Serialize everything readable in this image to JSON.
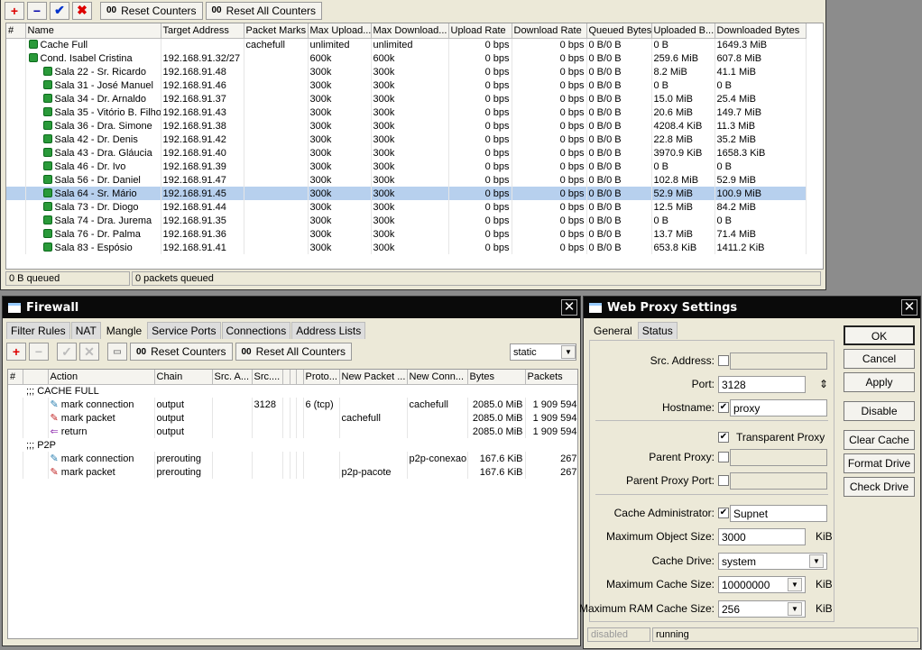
{
  "queues": {
    "toolbar": {
      "add": "+",
      "remove": "−",
      "enable": "✔",
      "disable": "✖",
      "reset_counters": "Reset Counters",
      "reset_all_counters": "Reset All Counters",
      "counter_glyph": "00"
    },
    "columns": [
      "#",
      "Name",
      "Target Address",
      "Packet Marks",
      "Max Upload...",
      "Max Download...",
      "Upload Rate",
      "Download Rate",
      "Queued Bytes",
      "Uploaded B...",
      "Downloaded Bytes"
    ],
    "rows": [
      {
        "level": 0,
        "name": "Cache Full",
        "target": "",
        "marks": "cachefull",
        "max_up": "unlimited",
        "max_down": "unlimited",
        "up_rate": "0 bps",
        "down_rate": "0 bps",
        "queued": "0 B/0 B",
        "uploaded": "0 B",
        "downloaded": "1649.3 MiB"
      },
      {
        "level": 0,
        "name": "Cond. Isabel Cristina",
        "target": "192.168.91.32/27",
        "marks": "",
        "max_up": "600k",
        "max_down": "600k",
        "up_rate": "0 bps",
        "down_rate": "0 bps",
        "queued": "0 B/0 B",
        "uploaded": "259.6 MiB",
        "downloaded": "607.8 MiB"
      },
      {
        "level": 1,
        "name": "Sala 22 - Sr. Ricardo",
        "target": "192.168.91.48",
        "marks": "",
        "max_up": "300k",
        "max_down": "300k",
        "up_rate": "0 bps",
        "down_rate": "0 bps",
        "queued": "0 B/0 B",
        "uploaded": "8.2 MiB",
        "downloaded": "41.1 MiB"
      },
      {
        "level": 1,
        "name": "Sala 31 - José Manuel",
        "target": "192.168.91.46",
        "marks": "",
        "max_up": "300k",
        "max_down": "300k",
        "up_rate": "0 bps",
        "down_rate": "0 bps",
        "queued": "0 B/0 B",
        "uploaded": "0 B",
        "downloaded": "0 B"
      },
      {
        "level": 1,
        "name": "Sala 34 - Dr. Arnaldo",
        "target": "192.168.91.37",
        "marks": "",
        "max_up": "300k",
        "max_down": "300k",
        "up_rate": "0 bps",
        "down_rate": "0 bps",
        "queued": "0 B/0 B",
        "uploaded": "15.0 MiB",
        "downloaded": "25.4 MiB"
      },
      {
        "level": 1,
        "name": "Sala 35 - Vitório B. Filho",
        "target": "192.168.91.43",
        "marks": "",
        "max_up": "300k",
        "max_down": "300k",
        "up_rate": "0 bps",
        "down_rate": "0 bps",
        "queued": "0 B/0 B",
        "uploaded": "20.6 MiB",
        "downloaded": "149.7 MiB"
      },
      {
        "level": 1,
        "name": "Sala 36 - Dra. Simone",
        "target": "192.168.91.38",
        "marks": "",
        "max_up": "300k",
        "max_down": "300k",
        "up_rate": "0 bps",
        "down_rate": "0 bps",
        "queued": "0 B/0 B",
        "uploaded": "4208.4 KiB",
        "downloaded": "11.3 MiB"
      },
      {
        "level": 1,
        "name": "Sala 42 - Dr. Denis",
        "target": "192.168.91.42",
        "marks": "",
        "max_up": "300k",
        "max_down": "300k",
        "up_rate": "0 bps",
        "down_rate": "0 bps",
        "queued": "0 B/0 B",
        "uploaded": "22.8 MiB",
        "downloaded": "35.2 MiB"
      },
      {
        "level": 1,
        "name": "Sala 43 - Dra. Gláucia",
        "target": "192.168.91.40",
        "marks": "",
        "max_up": "300k",
        "max_down": "300k",
        "up_rate": "0 bps",
        "down_rate": "0 bps",
        "queued": "0 B/0 B",
        "uploaded": "3970.9 KiB",
        "downloaded": "1658.3 KiB"
      },
      {
        "level": 1,
        "name": "Sala 46 - Dr. Ivo",
        "target": "192.168.91.39",
        "marks": "",
        "max_up": "300k",
        "max_down": "300k",
        "up_rate": "0 bps",
        "down_rate": "0 bps",
        "queued": "0 B/0 B",
        "uploaded": "0 B",
        "downloaded": "0 B"
      },
      {
        "level": 1,
        "name": "Sala 56 - Dr. Daniel",
        "target": "192.168.91.47",
        "marks": "",
        "max_up": "300k",
        "max_down": "300k",
        "up_rate": "0 bps",
        "down_rate": "0 bps",
        "queued": "0 B/0 B",
        "uploaded": "102.8 MiB",
        "downloaded": "52.9 MiB"
      },
      {
        "level": 1,
        "name": "Sala 64 - Sr. Mário",
        "target": "192.168.91.45",
        "marks": "",
        "max_up": "300k",
        "max_down": "300k",
        "up_rate": "0 bps",
        "down_rate": "0 bps",
        "queued": "0 B/0 B",
        "uploaded": "52.9 MiB",
        "downloaded": "100.9 MiB",
        "selected": true
      },
      {
        "level": 1,
        "name": "Sala 73 - Dr. Diogo",
        "target": "192.168.91.44",
        "marks": "",
        "max_up": "300k",
        "max_down": "300k",
        "up_rate": "0 bps",
        "down_rate": "0 bps",
        "queued": "0 B/0 B",
        "uploaded": "12.5 MiB",
        "downloaded": "84.2 MiB"
      },
      {
        "level": 1,
        "name": "Sala 74 - Dra. Jurema",
        "target": "192.168.91.35",
        "marks": "",
        "max_up": "300k",
        "max_down": "300k",
        "up_rate": "0 bps",
        "down_rate": "0 bps",
        "queued": "0 B/0 B",
        "uploaded": "0 B",
        "downloaded": "0 B"
      },
      {
        "level": 1,
        "name": "Sala 76 - Dr. Palma",
        "target": "192.168.91.36",
        "marks": "",
        "max_up": "300k",
        "max_down": "300k",
        "up_rate": "0 bps",
        "down_rate": "0 bps",
        "queued": "0 B/0 B",
        "uploaded": "13.7 MiB",
        "downloaded": "71.4 MiB"
      },
      {
        "level": 1,
        "name": "Sala 83 - Espósio",
        "target": "192.168.91.41",
        "marks": "",
        "max_up": "300k",
        "max_down": "300k",
        "up_rate": "0 bps",
        "down_rate": "0 bps",
        "queued": "0 B/0 B",
        "uploaded": "653.8 KiB",
        "downloaded": "1411.2 KiB"
      }
    ],
    "status": {
      "queued": "0 B queued",
      "packets": "0 packets queued"
    }
  },
  "firewall": {
    "title": "Firewall",
    "tabs": [
      "Filter Rules",
      "NAT",
      "Mangle",
      "Service Ports",
      "Connections",
      "Address Lists"
    ],
    "active_tab": "Mangle",
    "toolbar": {
      "reset_counters": "Reset Counters",
      "reset_all_counters": "Reset All Counters",
      "counter_glyph": "00",
      "filter": "static"
    },
    "columns": [
      "#",
      "",
      "Action",
      "Chain",
      "Src. A...",
      "Src....",
      "",
      "",
      "",
      "Proto...",
      "New Packet ...",
      "New Conn...",
      "Bytes",
      "Packets"
    ],
    "rows": [
      {
        "comment": ";;; CACHE FULL"
      },
      {
        "icon": "pencil-icon",
        "icon_color": "#2a7fb0",
        "action": "mark connection",
        "chain": "output",
        "src_port": "3128",
        "proto": "6 (tcp)",
        "new_packet": "",
        "new_conn": "cachefull",
        "bytes": "2085.0 MiB",
        "packets": "1 909 594"
      },
      {
        "icon": "pencil-icon",
        "icon_color": "#c02020",
        "action": "mark packet",
        "chain": "output",
        "src_port": "",
        "proto": "",
        "new_packet": "cachefull",
        "new_conn": "",
        "bytes": "2085.0 MiB",
        "packets": "1 909 594"
      },
      {
        "icon": "return-arrow-icon",
        "icon_color": "#9030b0",
        "action": "return",
        "chain": "output",
        "src_port": "",
        "proto": "",
        "new_packet": "",
        "new_conn": "",
        "bytes": "2085.0 MiB",
        "packets": "1 909 594"
      },
      {
        "comment": ";;; P2P"
      },
      {
        "icon": "pencil-icon",
        "icon_color": "#2a7fb0",
        "action": "mark connection",
        "chain": "prerouting",
        "src_port": "",
        "proto": "",
        "new_packet": "",
        "new_conn": "p2p-conexao",
        "bytes": "167.6 KiB",
        "packets": "267"
      },
      {
        "icon": "pencil-icon",
        "icon_color": "#c02020",
        "action": "mark packet",
        "chain": "prerouting",
        "src_port": "",
        "proto": "",
        "new_packet": "p2p-pacote",
        "new_conn": "",
        "bytes": "167.6 KiB",
        "packets": "267"
      }
    ]
  },
  "proxy": {
    "title": "Web Proxy Settings",
    "tabs": [
      "General",
      "Status"
    ],
    "labels": {
      "src_address": "Src. Address:",
      "port": "Port:",
      "hostname": "Hostname:",
      "transparent": "Transparent Proxy",
      "parent_proxy": "Parent Proxy:",
      "parent_proxy_port": "Parent Proxy Port:",
      "cache_admin": "Cache Administrator:",
      "max_object": "Maximum Object Size:",
      "cache_drive": "Cache Drive:",
      "max_cache": "Maximum Cache Size:",
      "max_ram": "Maximum RAM Cache Size:",
      "kib": "KiB"
    },
    "values": {
      "port": "3128",
      "hostname": "proxy",
      "cache_admin": "Supnet",
      "max_object": "3000",
      "cache_drive": "system",
      "max_cache": "10000000",
      "max_ram": "256"
    },
    "checks": {
      "src_address": false,
      "hostname": true,
      "transparent": true,
      "parent_proxy": false,
      "parent_proxy_port": false,
      "cache_admin": true
    },
    "buttons": [
      "OK",
      "Cancel",
      "Apply",
      "Disable",
      "Clear Cache",
      "Format Drive",
      "Check Drive"
    ],
    "status": {
      "left": "disabled",
      "right": "running"
    }
  }
}
